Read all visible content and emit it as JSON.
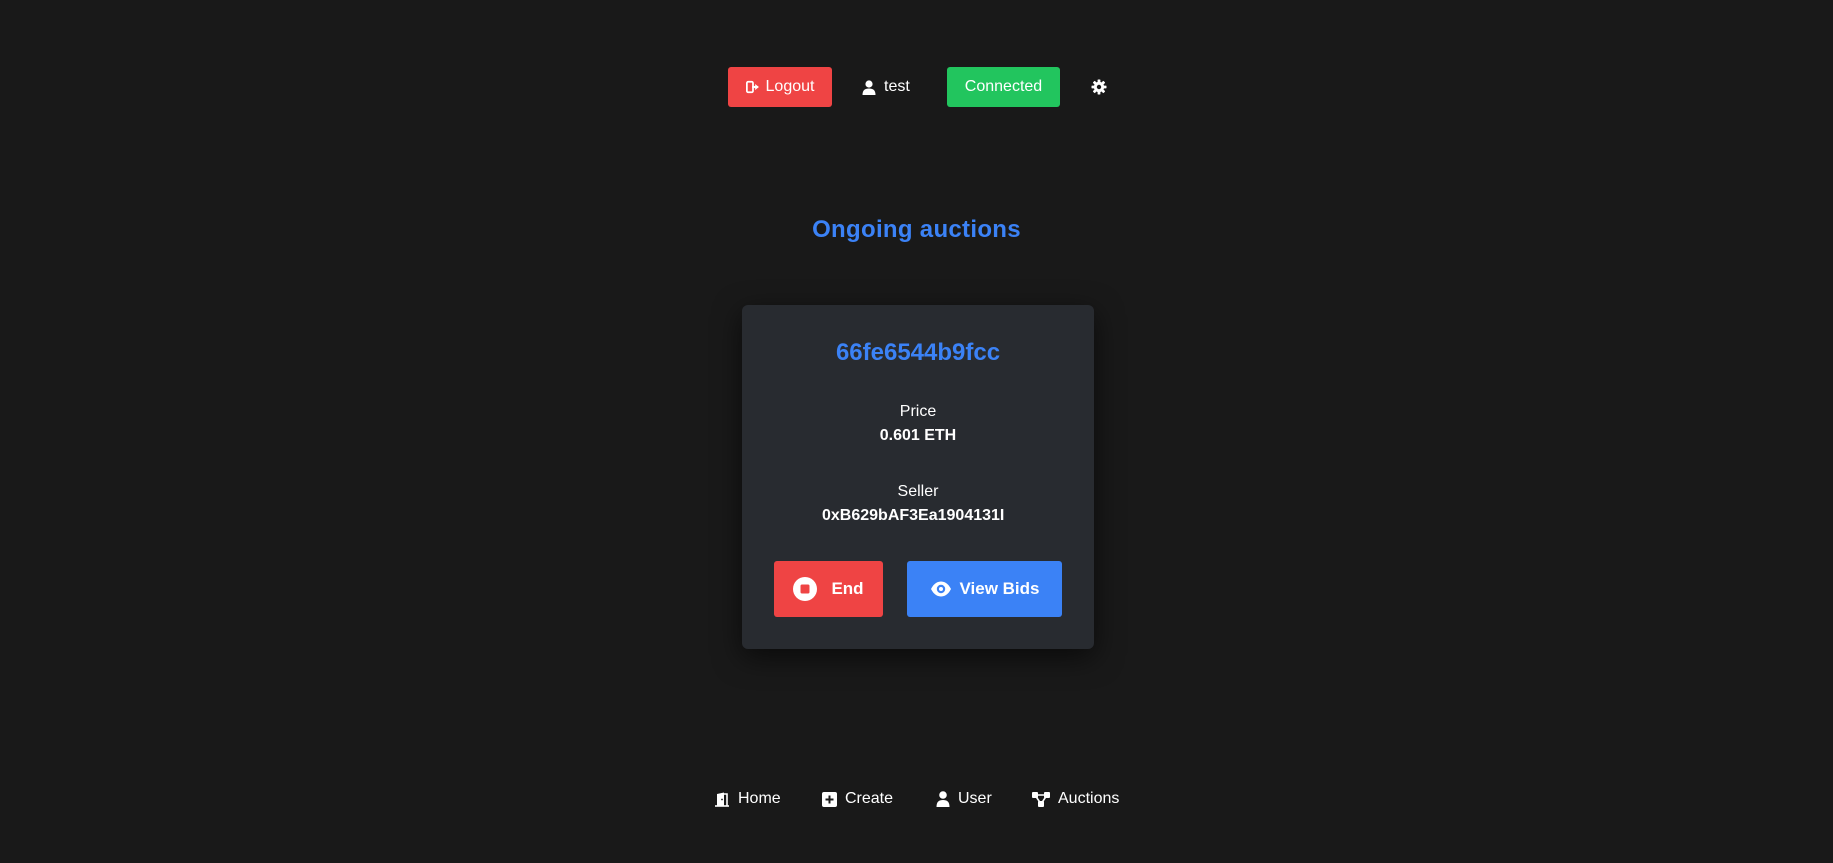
{
  "header": {
    "logout_label": "Logout",
    "username": "test",
    "connection_status": "Connected"
  },
  "main": {
    "title": "Ongoing auctions",
    "auction": {
      "id": "66fe6544b9fcc",
      "price_label": "Price",
      "price_value": "0.601 ETH",
      "seller_label": "Seller",
      "seller_value": "0xB629bAF3Ea1904131I",
      "end_label": "End",
      "view_bids_label": "View Bids"
    }
  },
  "nav": {
    "items": [
      {
        "label": "Home",
        "icon": "door-open-icon"
      },
      {
        "label": "Create",
        "icon": "plus-square-icon"
      },
      {
        "label": "User",
        "icon": "user-icon"
      },
      {
        "label": "Auctions",
        "icon": "network-icon"
      }
    ]
  },
  "colors": {
    "background": "#191919",
    "card": "#282b30",
    "accent_blue": "#3b82f6",
    "danger_red": "#ef4444",
    "success_green": "#22c55e"
  }
}
